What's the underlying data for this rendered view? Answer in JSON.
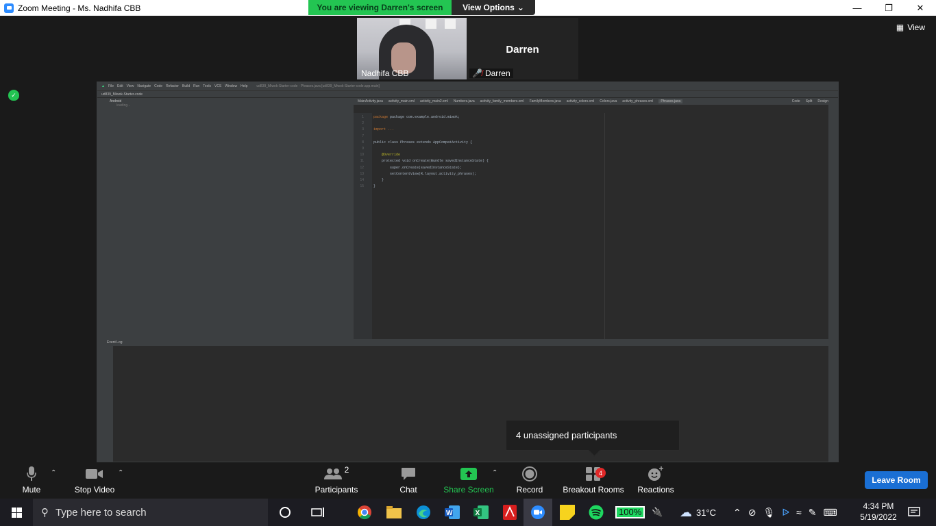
{
  "window": {
    "title": "Zoom Meeting - Ms. Nadhifa CBB",
    "minimize_icon": "minimize-icon",
    "maximize_icon": "restore-icon",
    "close_icon": "close-icon"
  },
  "share_banner": {
    "viewing_text": "You are viewing Darren's screen",
    "view_options_label": "View Options"
  },
  "participants_strip": [
    {
      "name": "Nadhifa CBB",
      "video": true
    },
    {
      "name": "Darren",
      "display_name": "Darren",
      "muted": true,
      "video": false
    }
  ],
  "view_button": {
    "label": "View"
  },
  "shared_screen": {
    "ide_menu": [
      "File",
      "Edit",
      "View",
      "Navigate",
      "Code",
      "Refactor",
      "Build",
      "Run",
      "Tools",
      "VCS",
      "Window",
      "Help"
    ],
    "ide_title": "ud839_Miwok-Starter-code - Phrases.java [ud839_Miwok-Starter-code.app.main]",
    "project_root": "ud839_Miwok-Starter-code",
    "project_view": "Android",
    "project_loading": "loading...",
    "tabs": [
      "MainActivity.java",
      "activity_main.xml",
      "activity_main2.xml",
      "Numbers.java",
      "activity_family_members.xml",
      "FamilyMembers.java",
      "activity_colors.xml",
      "Colors.java",
      "activity_phrases.xml",
      "Phrases.java"
    ],
    "active_tab": "Phrases.java",
    "line_numbers": "1\n2\n3\n7\n8\n9\n10\n11\n12\n13\n14\n15",
    "code": {
      "l1": "package com.example.android.miwok;",
      "l3": "import ...",
      "l7": "public class Phrases extends AppCompatActivity {",
      "l9": "@Override",
      "l10": "protected void onCreate(Bundle savedInstanceState) {",
      "l11": "super.onCreate(savedInstanceState);",
      "l12": "setContentView(R.layout.activity_phrases);",
      "l13": "}",
      "l14": "}"
    },
    "view_modes": [
      "Code",
      "Split",
      "Design"
    ],
    "event_log_label": "Event Log"
  },
  "toast": {
    "text": "4 unassigned participants"
  },
  "controls": {
    "mute": "Mute",
    "stop_video": "Stop Video",
    "participants": "Participants",
    "participants_count": "2",
    "chat": "Chat",
    "share_screen": "Share Screen",
    "record": "Record",
    "breakout_rooms": "Breakout Rooms",
    "breakout_badge": "4",
    "reactions": "Reactions",
    "leave_room": "Leave Room"
  },
  "taskbar": {
    "search_placeholder": "Type here to search",
    "battery": "100%",
    "temperature": "31°C",
    "time": "4:34 PM",
    "date": "5/19/2022",
    "apps": [
      "chrome-icon",
      "file-explorer-icon",
      "edge-icon",
      "word-icon",
      "excel-icon",
      "acrobat-icon",
      "zoom-icon",
      "sticky-notes-icon",
      "spotify-icon"
    ]
  },
  "colors": {
    "banner_green": "#23c552",
    "leave_blue": "#1a6fd4",
    "badge_red": "#e02828",
    "share_green": "#23c552"
  }
}
